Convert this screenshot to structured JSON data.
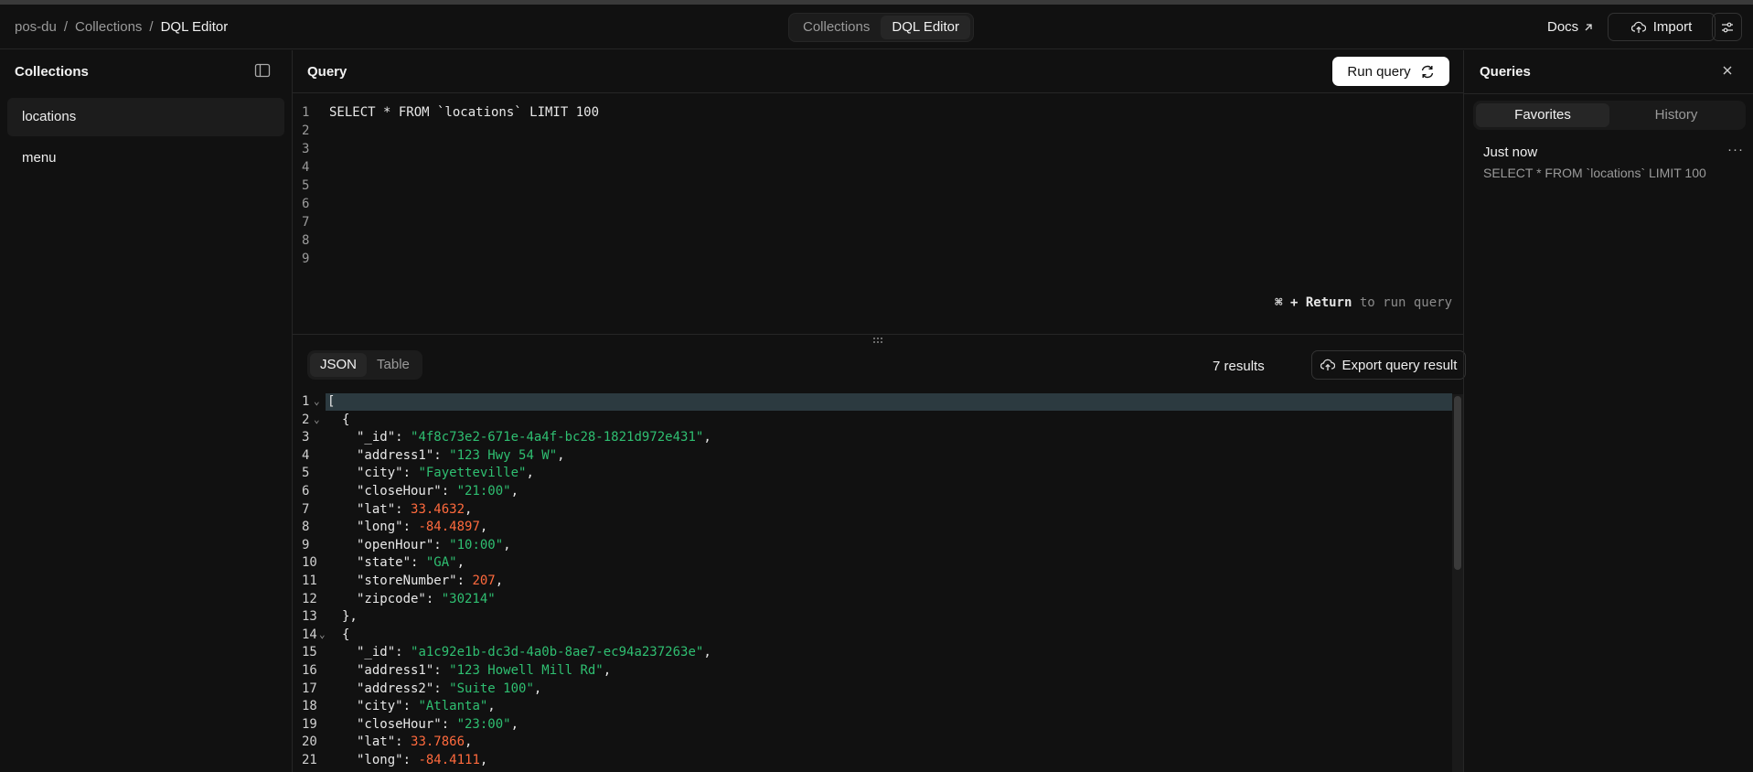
{
  "breadcrumb": {
    "workspace": "pos-du",
    "section": "Collections",
    "current": "DQL Editor",
    "sep": "/"
  },
  "header": {
    "nav": [
      {
        "label": "Collections",
        "active": false
      },
      {
        "label": "DQL Editor",
        "active": true
      }
    ],
    "docs_label": "Docs",
    "import_label": "Import"
  },
  "sidebar": {
    "title": "Collections",
    "items": [
      {
        "label": "locations",
        "active": true
      },
      {
        "label": "menu",
        "active": false
      }
    ]
  },
  "query": {
    "title": "Query",
    "run_label": "Run query",
    "lines": [
      "SELECT * FROM `locations` LIMIT 100",
      "",
      "",
      "",
      "",
      "",
      "",
      "",
      ""
    ],
    "line_numbers": [
      "1",
      "2",
      "3",
      "4",
      "5",
      "6",
      "7",
      "8",
      "9"
    ],
    "hint_keys": "⌘ + Return",
    "hint_text": " to run query"
  },
  "results": {
    "tabs": [
      {
        "label": "JSON",
        "active": true
      },
      {
        "label": "Table",
        "active": false
      }
    ],
    "count_label": "7 results",
    "export_label": "Export query result",
    "json_lines": [
      {
        "n": "1",
        "fold": true,
        "indent": 0,
        "key": "",
        "val": "[",
        "type": "punct"
      },
      {
        "n": "2",
        "fold": true,
        "indent": 1,
        "key": "",
        "val": "{",
        "type": "punct"
      },
      {
        "n": "3",
        "indent": 2,
        "key": "\"_id\"",
        "val": "\"4f8c73e2-671e-4a4f-bc28-1821d972e431\"",
        "type": "s",
        "tail": ","
      },
      {
        "n": "4",
        "indent": 2,
        "key": "\"address1\"",
        "val": "\"123 Hwy 54 W\"",
        "type": "s",
        "tail": ","
      },
      {
        "n": "5",
        "indent": 2,
        "key": "\"city\"",
        "val": "\"Fayetteville\"",
        "type": "s",
        "tail": ","
      },
      {
        "n": "6",
        "indent": 2,
        "key": "\"closeHour\"",
        "val": "\"21:00\"",
        "type": "s",
        "tail": ","
      },
      {
        "n": "7",
        "indent": 2,
        "key": "\"lat\"",
        "val": "33.4632",
        "type": "n",
        "tail": ","
      },
      {
        "n": "8",
        "indent": 2,
        "key": "\"long\"",
        "val": "-84.4897",
        "type": "n",
        "tail": ","
      },
      {
        "n": "9",
        "indent": 2,
        "key": "\"openHour\"",
        "val": "\"10:00\"",
        "type": "s",
        "tail": ","
      },
      {
        "n": "10",
        "indent": 2,
        "key": "\"state\"",
        "val": "\"GA\"",
        "type": "s",
        "tail": ","
      },
      {
        "n": "11",
        "indent": 2,
        "key": "\"storeNumber\"",
        "val": "207",
        "type": "n",
        "tail": ","
      },
      {
        "n": "12",
        "indent": 2,
        "key": "\"zipcode\"",
        "val": "\"30214\"",
        "type": "s",
        "tail": ""
      },
      {
        "n": "13",
        "indent": 1,
        "key": "",
        "val": "},",
        "type": "punct"
      },
      {
        "n": "14",
        "fold": true,
        "indent": 1,
        "key": "",
        "val": "{",
        "type": "punct"
      },
      {
        "n": "15",
        "indent": 2,
        "key": "\"_id\"",
        "val": "\"a1c92e1b-dc3d-4a0b-8ae7-ec94a237263e\"",
        "type": "s",
        "tail": ","
      },
      {
        "n": "16",
        "indent": 2,
        "key": "\"address1\"",
        "val": "\"123 Howell Mill Rd\"",
        "type": "s",
        "tail": ","
      },
      {
        "n": "17",
        "indent": 2,
        "key": "\"address2\"",
        "val": "\"Suite 100\"",
        "type": "s",
        "tail": ","
      },
      {
        "n": "18",
        "indent": 2,
        "key": "\"city\"",
        "val": "\"Atlanta\"",
        "type": "s",
        "tail": ","
      },
      {
        "n": "19",
        "indent": 2,
        "key": "\"closeHour\"",
        "val": "\"23:00\"",
        "type": "s",
        "tail": ","
      },
      {
        "n": "20",
        "indent": 2,
        "key": "\"lat\"",
        "val": "33.7866",
        "type": "n",
        "tail": ","
      },
      {
        "n": "21",
        "indent": 2,
        "key": "\"long\"",
        "val": "-84.4111",
        "type": "n",
        "tail": ","
      }
    ]
  },
  "queries_panel": {
    "title": "Queries",
    "tabs": [
      {
        "label": "Favorites",
        "active": true
      },
      {
        "label": "History",
        "active": false
      }
    ],
    "entries": [
      {
        "time": "Just now",
        "text": "SELECT * FROM `locations` LIMIT 100",
        "more": "···"
      }
    ]
  },
  "colors": {
    "string": "#2fbf71",
    "number": "#ff6a3d",
    "background": "#111111",
    "accent_button": "#ffffff"
  },
  "icons": [
    "arrow-up-right-icon",
    "cloud-upload-icon",
    "sliders-icon",
    "sidebar-collapse-icon",
    "refresh-icon",
    "grip-icon",
    "chevron-down-icon",
    "close-icon",
    "more-icon"
  ]
}
